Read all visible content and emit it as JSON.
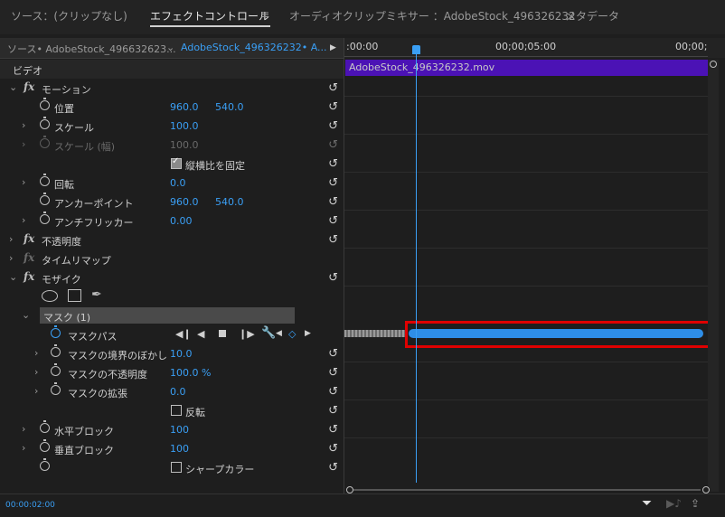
{
  "tabs": {
    "source": "ソース：(クリップなし)",
    "effect_controls": "エフェクトコントロール",
    "menu_icon": "≡",
    "audio_mixer": "オーディオクリップミキサー ：AdobeStock_496326232",
    "metadata": "メタデータ"
  },
  "header": {
    "source_clip": "ソース• AdobeStock_496632623...",
    "seq_clip": "AdobeStock_496326232• A...",
    "ruler_start": ":00:00",
    "ruler_mid": "00;00;05:00",
    "ruler_end": "00;00;"
  },
  "section_video": "ビデオ",
  "rows": {
    "motion": "モーション",
    "position": "位置",
    "position_x": "960.0",
    "position_y": "540.0",
    "scale": "スケール",
    "scale_val": "100.0",
    "scale_width": "スケール (幅)",
    "scale_width_val": "100.0",
    "uniform_scale": "縦横比を固定",
    "rotation": "回転",
    "rotation_val": "0.0",
    "anchor": "アンカーポイント",
    "anchor_x": "960.0",
    "anchor_y": "540.0",
    "antiflicker": "アンチフリッカー",
    "antiflicker_val": "0.00",
    "opacity": "不透明度",
    "time_remap": "タイムリマップ",
    "mosaic": "モザイク",
    "mask": "マスク (1)",
    "mask_path": "マスクパス",
    "mask_feather": "マスクの境界のぼかし",
    "mask_feather_val": "10.0",
    "mask_opacity": "マスクの不透明度",
    "mask_opacity_val": "100.0 %",
    "mask_expansion": "マスクの拡張",
    "mask_expansion_val": "0.0",
    "inverted": "反転",
    "h_blocks": "水平ブロック",
    "h_blocks_val": "100",
    "v_blocks": "垂直ブロック",
    "v_blocks_val": "100",
    "sharp_colors": "シャープカラー"
  },
  "timeline": {
    "clip_name": "AdobeStock_496326232.mov"
  },
  "footer": {
    "timecode": "00:00:02:00"
  },
  "colors": {
    "accent": "#3a9ff5",
    "clip": "#4b12b5",
    "highlight": "#e00000"
  }
}
